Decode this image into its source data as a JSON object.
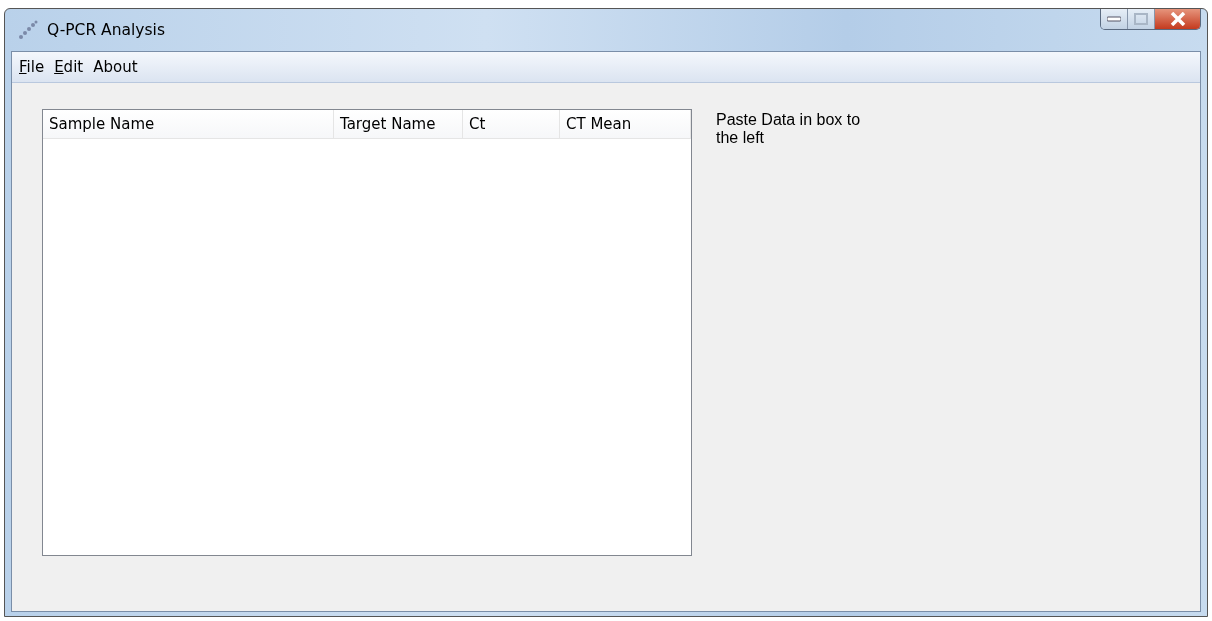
{
  "window": {
    "title": "Q-PCR Analysis"
  },
  "menu": [
    {
      "label": "File",
      "mnemonic": true
    },
    {
      "label": "Edit",
      "mnemonic": true
    },
    {
      "label": "About",
      "mnemonic": false
    }
  ],
  "table": {
    "columns": [
      "Sample Name",
      "Target Name",
      "Ct",
      "CT Mean"
    ]
  },
  "hint": "Paste Data in box to the left"
}
